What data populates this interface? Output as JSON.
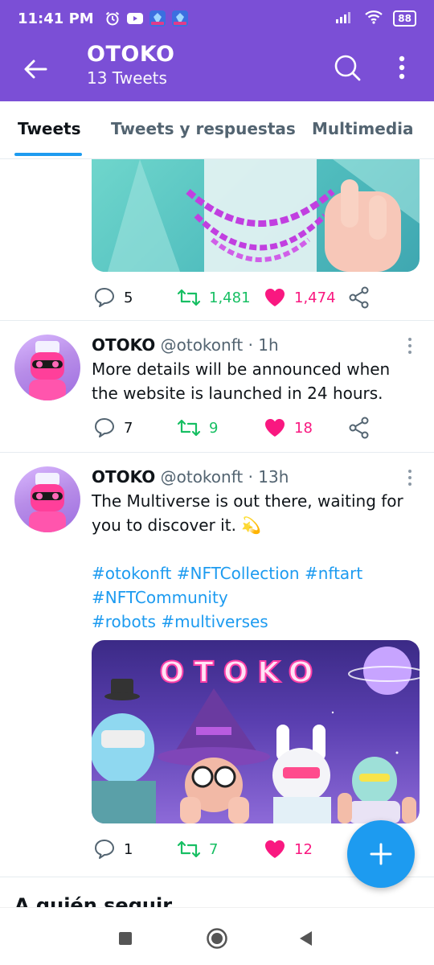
{
  "status_bar": {
    "time": "11:41 PM",
    "battery": "88",
    "icons": [
      "alarm-icon",
      "youtube-icon",
      "game-icon",
      "game-icon",
      "signal-icon",
      "wifi-icon",
      "battery-icon"
    ]
  },
  "header": {
    "title": "OTOKO",
    "subtitle": "13 Tweets",
    "back_icon": "back-arrow-icon",
    "search_icon": "search-icon",
    "more_icon": "more-vertical-icon"
  },
  "tabs": [
    {
      "label": "Tweets",
      "active": true
    },
    {
      "label": "Tweets y respuestas",
      "active": false
    },
    {
      "label": "Multimedia",
      "active": false
    }
  ],
  "tweets": [
    {
      "replies": "5",
      "retweets": "1,481",
      "likes": "1,474"
    },
    {
      "name": "OTOKO",
      "handle": "@otokonft · 1h",
      "text": "More details will be announced when the website is launched in 24 hours.",
      "replies": "7",
      "retweets": "9",
      "likes": "18"
    },
    {
      "name": "OTOKO",
      "handle": "@otokonft · 13h",
      "text": "The Multiverse is out there, waiting for you to discover it. 💫",
      "hashtags": [
        "#otokonft #NFTCollection #nftart",
        "#NFTCommunity",
        "#robots #multiverses"
      ],
      "media_text": "OTOKO",
      "replies": "1",
      "retweets": "7",
      "likes": "12"
    }
  ],
  "section": {
    "title": "A quién seguir"
  },
  "colors": {
    "brand": "#7b4fd6",
    "accent": "#1d9bf0",
    "retweet": "#17bf63",
    "like": "#f91880"
  }
}
